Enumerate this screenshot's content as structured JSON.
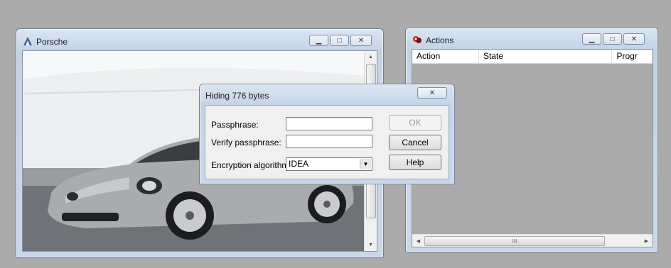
{
  "porsche_window": {
    "title": "Porsche",
    "icon": "app-icon"
  },
  "actions_window": {
    "title": "Actions",
    "icon": "actions-app-icon",
    "columns": [
      "Action",
      "State",
      "Progr"
    ]
  },
  "dialog": {
    "title": "Hiding 776 bytes",
    "passphrase_label": "Passphrase:",
    "passphrase_value": "",
    "verify_label": "Verify passphrase:",
    "verify_value": "",
    "algorithm_label": "Encryption algorithm:",
    "algorithm_value": "IDEA",
    "ok_label": "OK",
    "cancel_label": "Cancel",
    "help_label": "Help"
  },
  "scrollbar": {
    "thumb_grip": "III"
  }
}
